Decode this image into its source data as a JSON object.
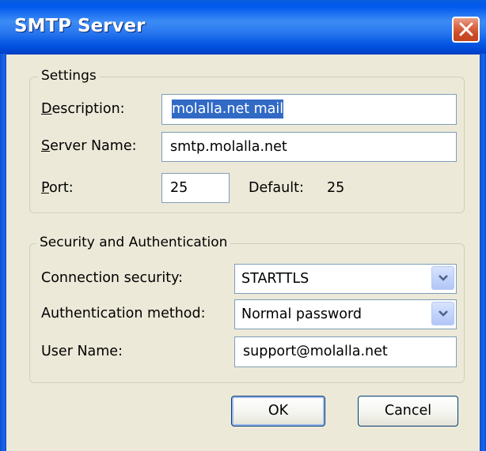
{
  "window": {
    "title": "SMTP Server"
  },
  "settings": {
    "group_title": "Settings",
    "description_label": "Description:",
    "description_value": "molalla.net mail",
    "server_name_label": "Server Name:",
    "server_name_value": "smtp.molalla.net",
    "port_label": "Port:",
    "port_value": "25",
    "default_label": "Default:",
    "default_value": "25"
  },
  "security": {
    "group_title": "Security and Authentication",
    "connection_security_label": "Connection security:",
    "connection_security_value": "STARTTLS",
    "auth_method_label": "Authentication method:",
    "auth_method_value": "Normal password",
    "user_name_label": "User Name:",
    "user_name_value": "support@molalla.net"
  },
  "buttons": {
    "ok": "OK",
    "cancel": "Cancel"
  },
  "colors": {
    "titlebar": "#0058ee",
    "dialog_bg": "#ece9d8",
    "selection": "#316ac5",
    "close_button": "#cc4a26"
  }
}
